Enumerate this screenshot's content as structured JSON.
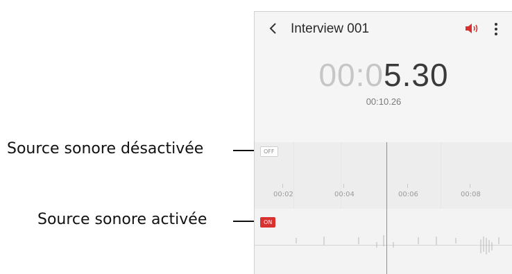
{
  "callouts": {
    "off_label": "Source sonore désactivée",
    "on_label": "Source sonore activée"
  },
  "app_bar": {
    "back_icon": "chevron-left-icon",
    "title": "Interview 001",
    "speaker_icon": "speaker-icon",
    "more_icon": "more-vertical-icon"
  },
  "timer": {
    "elapsed_dim": "00:0",
    "elapsed_main": "5.30",
    "total": "00:10.26"
  },
  "tracks": {
    "off_badge": "OFF",
    "on_badge": "ON"
  },
  "ruler": {
    "ticks": [
      "00:02",
      "00:04",
      "00:06",
      "00:08"
    ]
  },
  "colors": {
    "accent": "#d8312f",
    "playhead": "#e36b6b"
  }
}
